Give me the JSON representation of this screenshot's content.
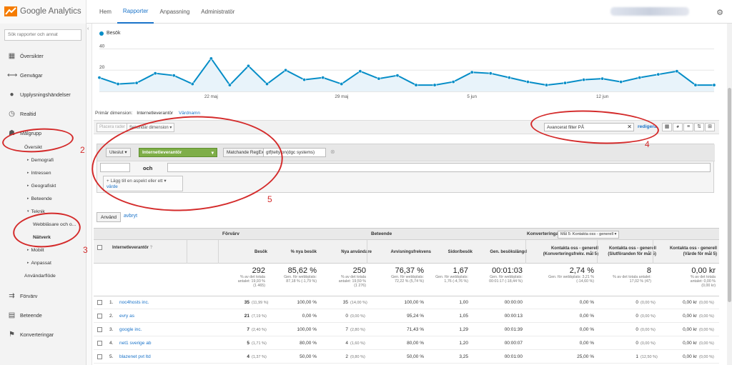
{
  "app": {
    "logo_text": "Google Analytics"
  },
  "topnav": [
    {
      "label": "Hem",
      "active": false
    },
    {
      "label": "Rapporter",
      "active": true
    },
    {
      "label": "Anpassning",
      "active": false
    },
    {
      "label": "Administratör",
      "active": false
    }
  ],
  "sidebar": {
    "search_placeholder": "Sök rapporter och annat",
    "items": [
      {
        "label": "Översikter",
        "icon": "grid-icon"
      },
      {
        "label": "Genvägar",
        "icon": "shortcut-icon"
      },
      {
        "label": "Upplysningshändelser",
        "icon": "lightbulb-icon"
      },
      {
        "label": "Realtid",
        "icon": "clock-icon"
      },
      {
        "label": "Målgrupp",
        "icon": "people-icon"
      }
    ],
    "audience_sub": {
      "oversikt": "Översikt",
      "demografi": "Demografi",
      "intressen": "Intressen",
      "geografiskt": "Geografiskt",
      "beteende": "Beteende",
      "teknik": "Teknik",
      "webblasare": "Webbläsare och o...",
      "natverk": "Nätverk",
      "mobilt": "Mobilt",
      "anpassat": "Anpassat",
      "anvandarflode": "Användarflöde"
    },
    "bottom_items": [
      {
        "label": "Förvärv",
        "icon": "acquisition-icon"
      },
      {
        "label": "Beteende",
        "icon": "behavior-icon"
      },
      {
        "label": "Konverteringar",
        "icon": "flag-icon"
      }
    ]
  },
  "chart_data": {
    "type": "line",
    "series": [
      {
        "name": "Besök",
        "color": "#058dc7",
        "values": [
          13,
          7,
          8,
          17,
          15,
          7,
          31,
          6,
          24,
          7,
          20,
          11,
          13,
          7,
          19,
          12,
          15,
          6,
          6,
          9,
          18,
          17,
          13,
          9,
          6,
          8,
          11,
          12,
          9,
          13,
          16,
          19,
          6,
          6
        ]
      }
    ],
    "y_ticks": [
      "40",
      "20"
    ],
    "x_tick_labels": [
      "22 maj",
      "29 maj",
      "5 jun",
      "12 jun"
    ],
    "ylim": [
      0,
      45
    ]
  },
  "primary_dimension": {
    "label": "Primär dimension:",
    "selected": "Internetleverantör",
    "other": "Värdnamn"
  },
  "toolbar": {
    "plot_rows": "Placera rader",
    "secondary_dim": "Sekundär dimension",
    "filter_value": "Avancerat filter PÅ",
    "edit": "redigera"
  },
  "advanced_filter": {
    "exclude": "Uteslut",
    "dimension": "Internetleverantör",
    "match": "Matchande RegExp",
    "value": "gtf|teltyfon(dgc systems)",
    "and": "och",
    "add_dim_text": "Lägg till en aspekt eller ett",
    "add_dim_link": "värde",
    "apply": "Använd",
    "cancel": "avbryt"
  },
  "table": {
    "group_acquisition": "Förvärv",
    "group_behavior": "Beteende",
    "group_conversions": "Konverteringar",
    "goal_select": "Mål 5: Kontakta oss - generell",
    "dim_header": "Internetleverantör",
    "headers": [
      "Besök",
      "% nya besök",
      "Nya användare",
      "Avvisningsfrekvens",
      "Sidor/besök",
      "Gen. besökslängd",
      "Kontakta oss - generell (Konverteringsfrekv. mål 5)",
      "Kontakta oss - generell (Slutföranden för mål 5)",
      "Kontakta oss - generell (Värde för mål 5)"
    ],
    "totals": [
      {
        "v": "292",
        "s1": "% av det totala",
        "s2": "antalet: 19,93 %",
        "s3": "(1 465)"
      },
      {
        "v": "85,62 %",
        "s1": "Gen. för webbplats:",
        "s2": "87,18 % (-1,79 %)",
        "s3": ""
      },
      {
        "v": "250",
        "s1": "% av det totala",
        "s2": "antalet: 19,59 %",
        "s3": "(1 276)"
      },
      {
        "v": "76,37 %",
        "s1": "Gen. för webbplats:",
        "s2": "72,22 % (5,74 %)",
        "s3": ""
      },
      {
        "v": "1,67",
        "s1": "Gen. för webbplats:",
        "s2": "1,76 (-4,76 %)",
        "s3": ""
      },
      {
        "v": "00:01:03",
        "s1": "Gen. för webbplats:",
        "s2": "00:01:17 (-18,44 %)",
        "s3": ""
      },
      {
        "v": "2,74 %",
        "s1": "Gen. för webbplats: 3,21 %",
        "s2": "(-14,60 %)",
        "s3": ""
      },
      {
        "v": "8",
        "s1": "% av det totala antalet:",
        "s2": "17,02 % (47)",
        "s3": ""
      },
      {
        "v": "0,00 kr",
        "s1": "% av det totala",
        "s2": "antalet: 0,00 %",
        "s3": "(0,00 kr)"
      }
    ],
    "rows": [
      {
        "n": "1.",
        "isp": "noc4hosts inc.",
        "visits": "35",
        "vp": "(11,99 %)",
        "newp": "100,00 %",
        "nu": "35",
        "nup": "(14,00 %)",
        "bounce": "100,00 %",
        "pps": "1,00",
        "dur": "00:00:00",
        "cr": "0,00 %",
        "comp": "0",
        "cp": "(0,00 %)",
        "val": "0,00 kr",
        "valp": "(0,00 %)"
      },
      {
        "n": "2.",
        "isp": "evry as",
        "visits": "21",
        "vp": "(7,19 %)",
        "newp": "0,00 %",
        "nu": "0",
        "nup": "(0,00 %)",
        "bounce": "95,24 %",
        "pps": "1,05",
        "dur": "00:00:13",
        "cr": "0,00 %",
        "comp": "0",
        "cp": "(0,00 %)",
        "val": "0,00 kr",
        "valp": "(0,00 %)"
      },
      {
        "n": "3.",
        "isp": "google inc.",
        "visits": "7",
        "vp": "(2,40 %)",
        "newp": "100,00 %",
        "nu": "7",
        "nup": "(2,80 %)",
        "bounce": "71,43 %",
        "pps": "1,29",
        "dur": "00:01:39",
        "cr": "0,00 %",
        "comp": "0",
        "cp": "(0,00 %)",
        "val": "0,00 kr",
        "valp": "(0,00 %)"
      },
      {
        "n": "4.",
        "isp": "net1 sverige ab",
        "visits": "5",
        "vp": "(1,71 %)",
        "newp": "80,00 %",
        "nu": "4",
        "nup": "(1,60 %)",
        "bounce": "80,00 %",
        "pps": "1,20",
        "dur": "00:00:07",
        "cr": "0,00 %",
        "comp": "0",
        "cp": "(0,00 %)",
        "val": "0,00 kr",
        "valp": "(0,00 %)"
      },
      {
        "n": "5.",
        "isp": "blazenet pvt ltd",
        "visits": "4",
        "vp": "(1,37 %)",
        "newp": "50,00 %",
        "nu": "2",
        "nup": "(0,80 %)",
        "bounce": "50,00 %",
        "pps": "3,25",
        "dur": "00:01:00",
        "cr": "25,00 %",
        "comp": "1",
        "cp": "(12,50 %)",
        "val": "0,00 kr",
        "valp": "(0,00 %)"
      }
    ]
  },
  "annotations": [
    "2",
    "3",
    "4",
    "5"
  ]
}
